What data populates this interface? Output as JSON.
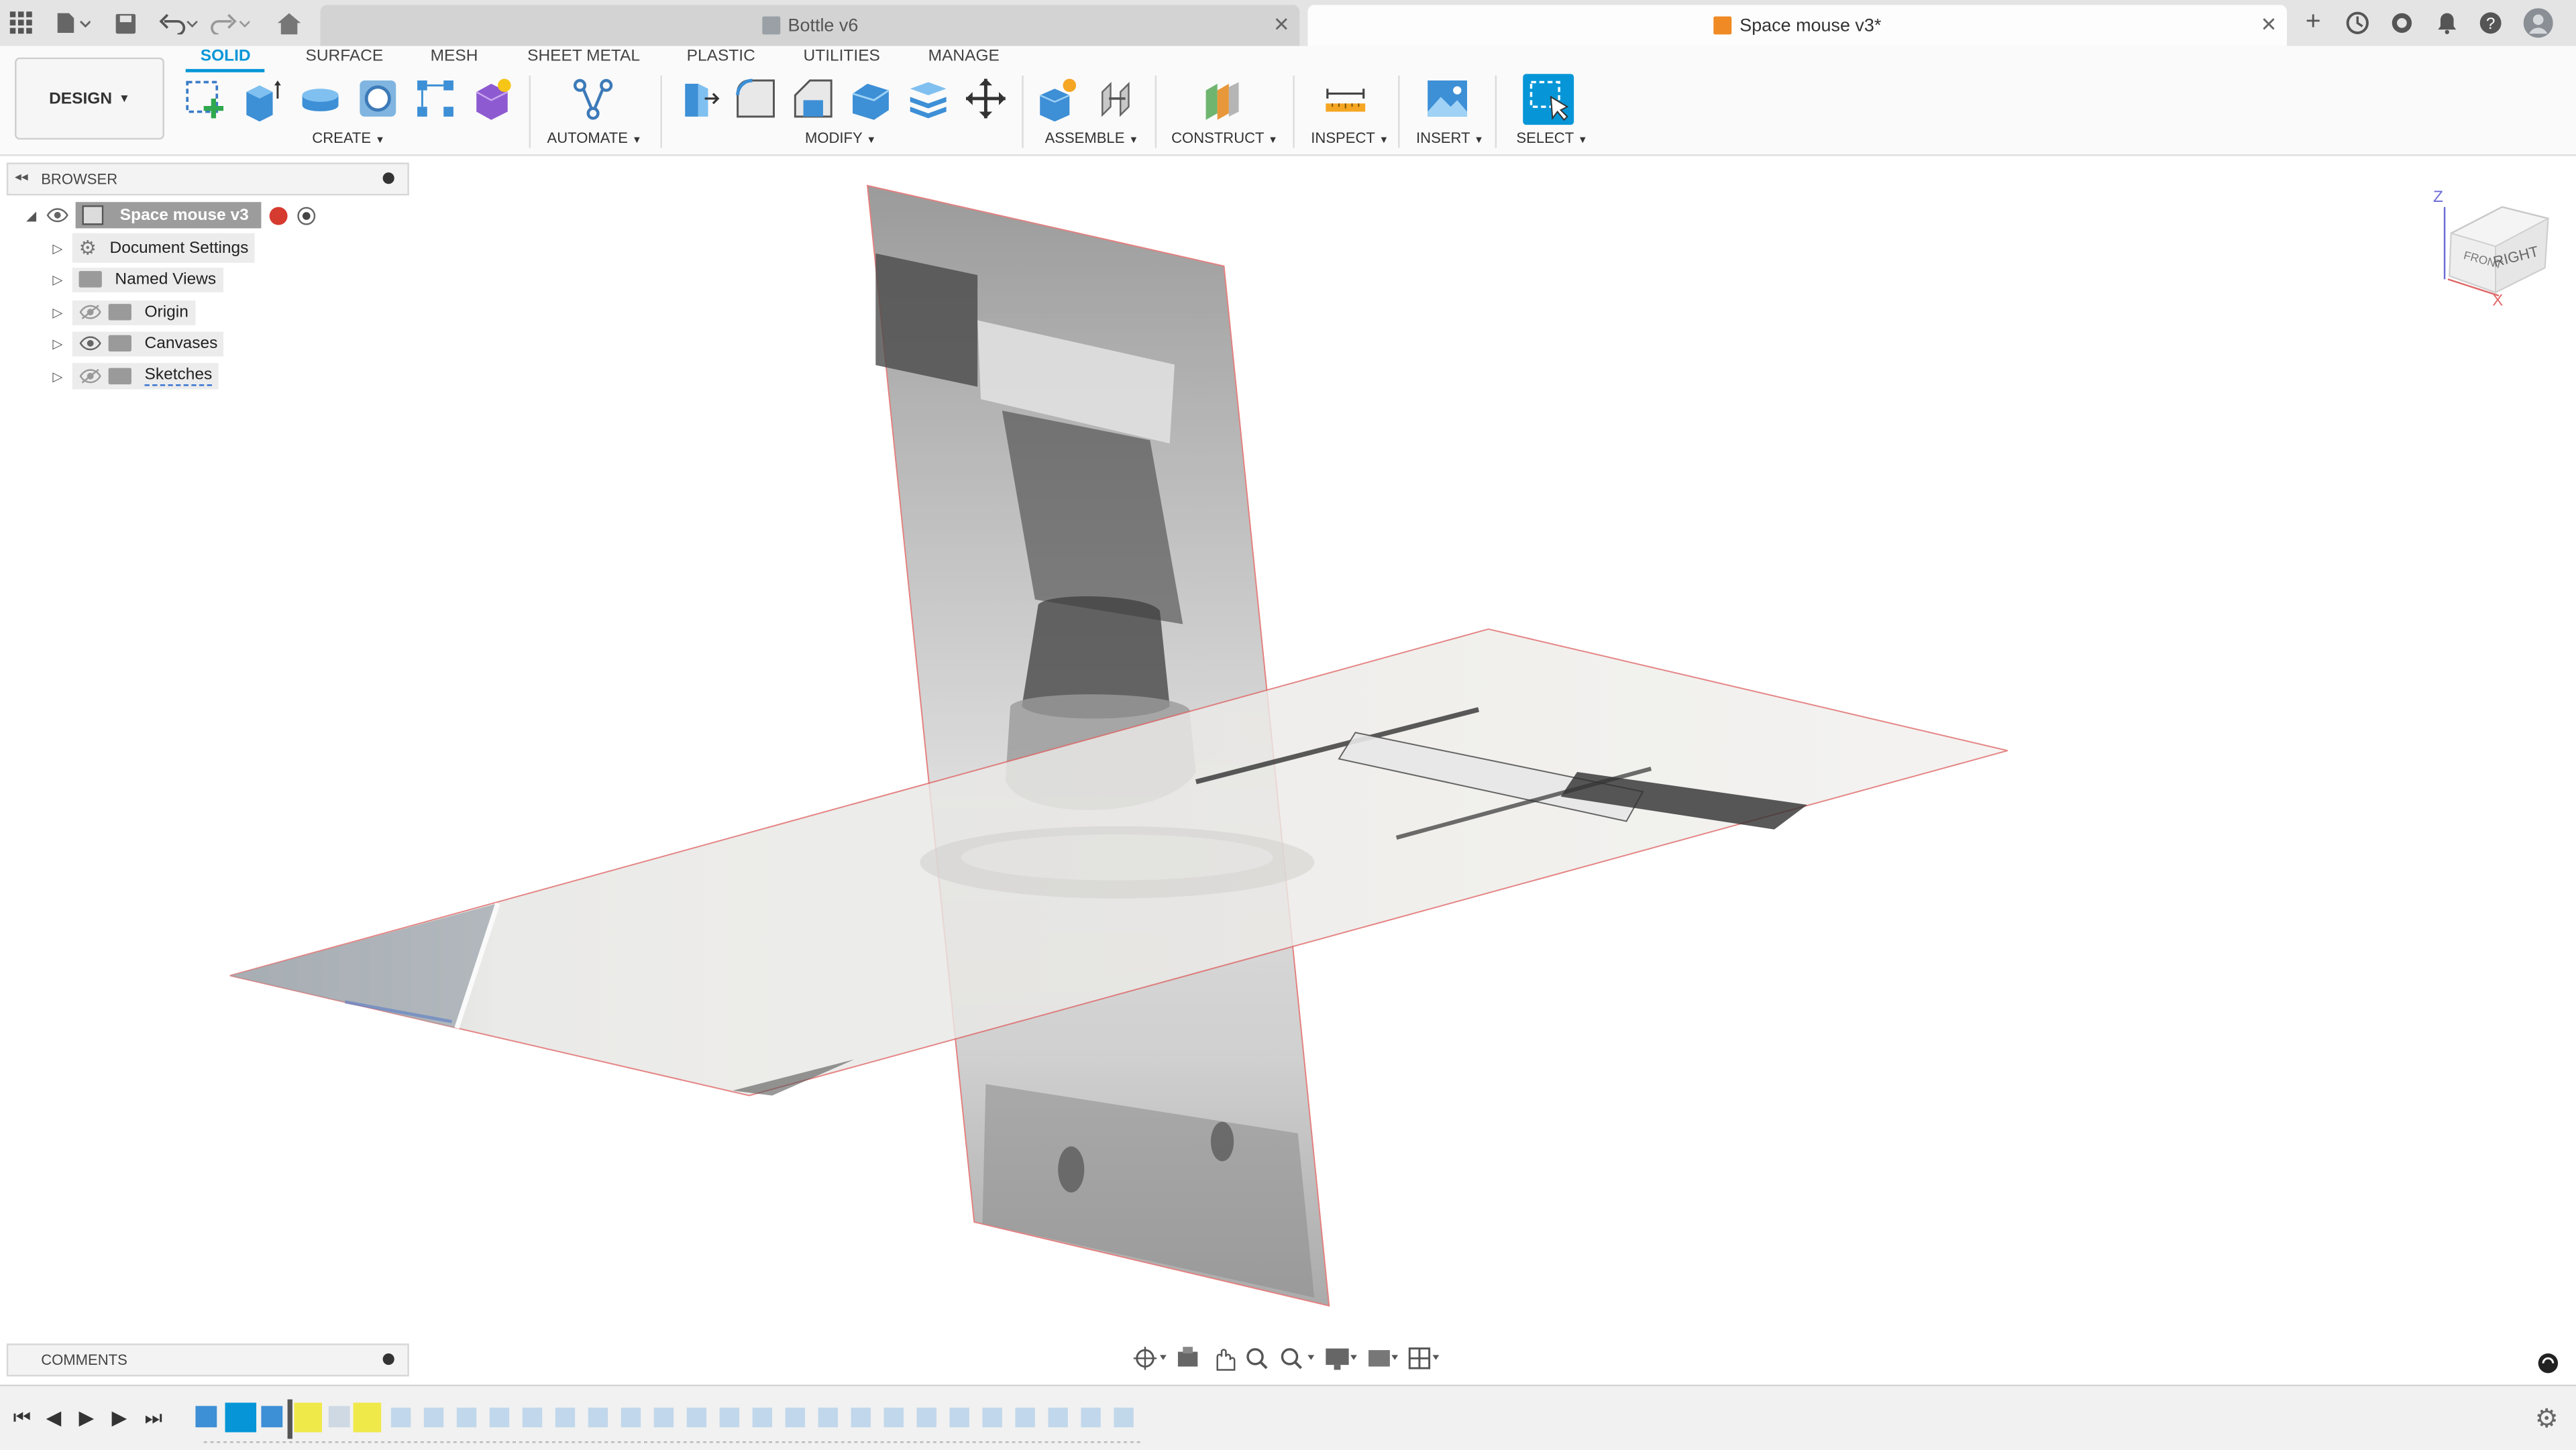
{
  "titlebar": {
    "tab_inactive": "Bottle v6",
    "tab_active": "Space mouse v3*"
  },
  "toolbar": {
    "workspace": "DESIGN",
    "tabs": [
      "SOLID",
      "SURFACE",
      "MESH",
      "SHEET METAL",
      "PLASTIC",
      "UTILITIES",
      "MANAGE"
    ],
    "groups": {
      "create": "CREATE",
      "automate": "AUTOMATE",
      "modify": "MODIFY",
      "assemble": "ASSEMBLE",
      "construct": "CONSTRUCT",
      "inspect": "INSPECT",
      "insert": "INSERT",
      "select": "SELECT"
    }
  },
  "browser": {
    "title": "BROWSER",
    "root": "Space mouse v3",
    "items": [
      "Document Settings",
      "Named Views",
      "Origin",
      "Canvases",
      "Sketches"
    ]
  },
  "comments": {
    "title": "COMMENTS"
  },
  "viewcube": {
    "front": "FRONT",
    "right": "RIGHT",
    "axis_z": "Z",
    "axis_x": "X"
  },
  "colors": {
    "accent": "#0696d7",
    "plane_edge": "#e06a6a",
    "selection_highlight": "#f0e94a"
  }
}
